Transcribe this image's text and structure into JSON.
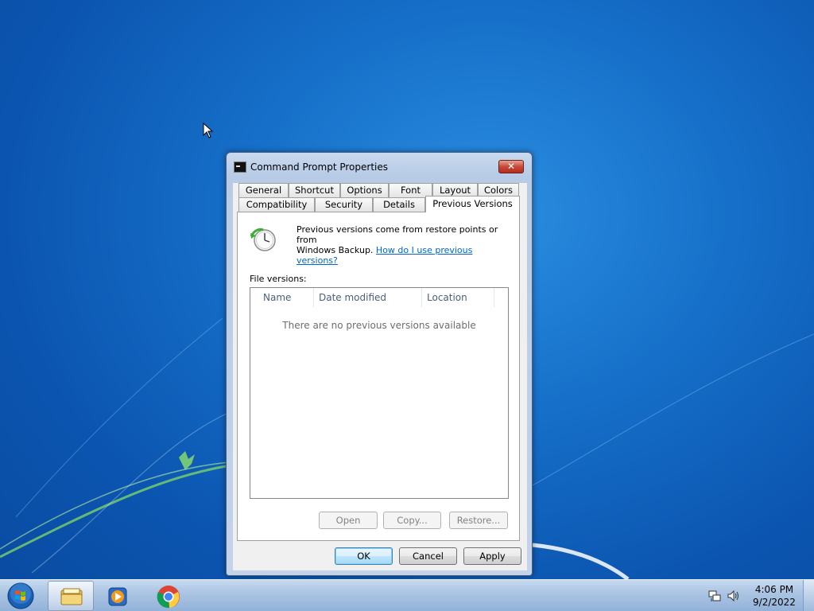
{
  "window": {
    "title": "Command Prompt Properties",
    "close_glyph": "✕"
  },
  "tabs_row1": [
    "General",
    "Shortcut",
    "Options",
    "Font",
    "Layout",
    "Colors"
  ],
  "tabs_row2": [
    "Compatibility",
    "Security",
    "Details",
    "Previous Versions"
  ],
  "active_tab": "Previous Versions",
  "panel": {
    "info_line1": "Previous versions come from restore points or from",
    "info_line2": "Windows Backup.",
    "help_link": "How do I use previous versions?",
    "file_versions_label": "File versions:",
    "columns": [
      "Name",
      "Date modified",
      "Location"
    ],
    "empty_message": "There are no previous versions available",
    "buttons": {
      "open": "Open",
      "copy": "Copy...",
      "restore": "Restore..."
    }
  },
  "dialog_buttons": {
    "ok": "OK",
    "cancel": "Cancel",
    "apply": "Apply"
  },
  "taskbar": {
    "time": "4:06 PM",
    "date": "9/2/2022",
    "pinned": [
      "file-explorer-icon",
      "media-player-icon",
      "chrome-icon"
    ]
  },
  "colors": {
    "desktop_blue": "#1670c9",
    "close_red": "#c84a3a",
    "link_blue": "#0066cc"
  }
}
